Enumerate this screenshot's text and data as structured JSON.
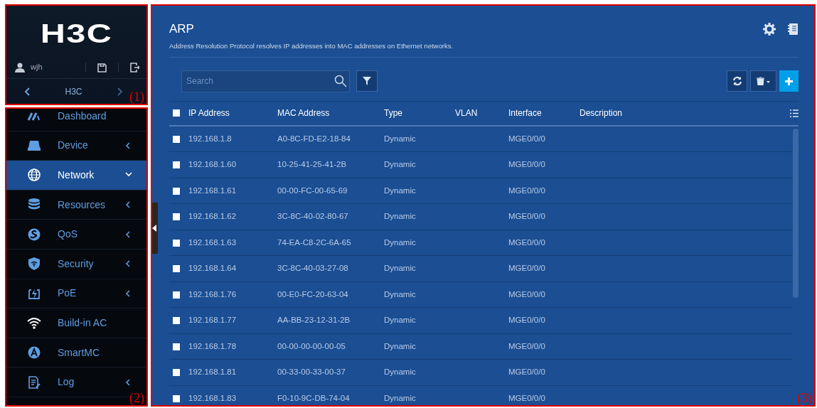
{
  "header": {
    "logo": "H3C",
    "user": "wjh",
    "device": "H3C"
  },
  "menu": [
    {
      "label": "Dashboard",
      "submenu": false,
      "selected": false
    },
    {
      "label": "Device",
      "submenu": true,
      "selected": false,
      "expanded": false
    },
    {
      "label": "Network",
      "submenu": true,
      "selected": true,
      "expanded": true
    },
    {
      "label": "Resources",
      "submenu": true,
      "selected": false,
      "expanded": false
    },
    {
      "label": "QoS",
      "submenu": true,
      "selected": false,
      "expanded": false
    },
    {
      "label": "Security",
      "submenu": true,
      "selected": false,
      "expanded": false
    },
    {
      "label": "PoE",
      "submenu": true,
      "selected": false,
      "expanded": false
    },
    {
      "label": "Build-in AC",
      "submenu": false,
      "selected": false
    },
    {
      "label": "SmartMC",
      "submenu": false,
      "selected": false
    },
    {
      "label": "Log",
      "submenu": true,
      "selected": false,
      "expanded": false
    }
  ],
  "page": {
    "title": "ARP",
    "description": "Address Resolution Protocol resolves IP addresses into MAC addresses on Ethernet networks."
  },
  "search": {
    "placeholder": "Search"
  },
  "table": {
    "columns": [
      "IP Address",
      "MAC Address",
      "Type",
      "VLAN",
      "Interface",
      "Description"
    ],
    "all_checked": false,
    "rows": [
      {
        "checked": false,
        "cells": [
          "192.168.1.8",
          "A0-8C-FD-E2-18-84",
          "Dynamic",
          "",
          "MGE0/0/0",
          ""
        ]
      },
      {
        "checked": false,
        "cells": [
          "192.168.1.60",
          "10-25-41-25-41-2B",
          "Dynamic",
          "",
          "MGE0/0/0",
          ""
        ]
      },
      {
        "checked": false,
        "cells": [
          "192.168.1.61",
          "00-00-FC-00-65-69",
          "Dynamic",
          "",
          "MGE0/0/0",
          ""
        ]
      },
      {
        "checked": false,
        "cells": [
          "192.168.1.62",
          "3C-8C-40-02-80-67",
          "Dynamic",
          "",
          "MGE0/0/0",
          ""
        ]
      },
      {
        "checked": false,
        "cells": [
          "192.168.1.63",
          "74-EA-C8-2C-6A-65",
          "Dynamic",
          "",
          "MGE0/0/0",
          ""
        ]
      },
      {
        "checked": false,
        "cells": [
          "192.168.1.64",
          "3C-8C-40-03-27-08",
          "Dynamic",
          "",
          "MGE0/0/0",
          ""
        ]
      },
      {
        "checked": false,
        "cells": [
          "192.168.1.76",
          "00-E0-FC-20-63-04",
          "Dynamic",
          "",
          "MGE0/0/0",
          ""
        ]
      },
      {
        "checked": false,
        "cells": [
          "192.168.1.77",
          "AA-BB-23-12-31-2B",
          "Dynamic",
          "",
          "MGE0/0/0",
          ""
        ]
      },
      {
        "checked": false,
        "cells": [
          "192.168.1.78",
          "00-00-00-00-00-05",
          "Dynamic",
          "",
          "MGE0/0/0",
          ""
        ]
      },
      {
        "checked": false,
        "cells": [
          "192.168.1.81",
          "00-33-00-33-00-37",
          "Dynamic",
          "",
          "MGE0/0/0",
          ""
        ]
      },
      {
        "checked": false,
        "cells": [
          "192.168.1.83",
          "F0-10-9C-DB-74-04",
          "Dynamic",
          "",
          "MGE0/0/0",
          ""
        ]
      }
    ]
  },
  "callouts": [
    "(1)",
    "(2)",
    "(3)"
  ]
}
